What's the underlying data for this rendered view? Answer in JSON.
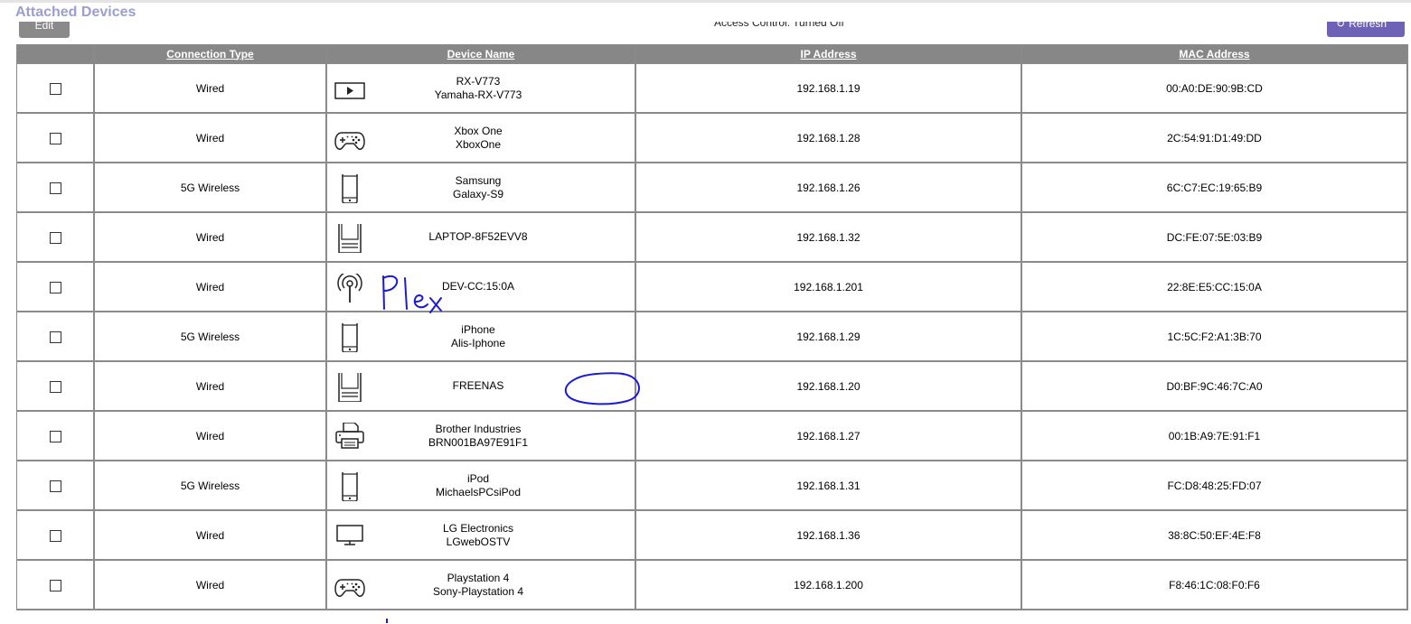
{
  "page": {
    "title": "Attached Devices",
    "edit_label": "Edit",
    "access_control": "Access Control: Turned Off",
    "refresh_label": "Refresh"
  },
  "table": {
    "headers": [
      "",
      "Connection Type",
      "Device Name",
      "IP Address",
      "MAC Address"
    ],
    "rows": [
      {
        "connection": "Wired",
        "icon": "media-player-icon",
        "name1": "RX-V773",
        "name2": "Yamaha-RX-V773",
        "ip": "192.168.1.19",
        "mac": "00:A0:DE:90:9B:CD"
      },
      {
        "connection": "Wired",
        "icon": "gamepad-icon",
        "name1": "Xbox One",
        "name2": "XboxOne",
        "ip": "192.168.1.28",
        "mac": "2C:54:91:D1:49:DD"
      },
      {
        "connection": "5G Wireless",
        "icon": "smartphone-icon",
        "name1": "Samsung",
        "name2": "Galaxy-S9",
        "ip": "192.168.1.26",
        "mac": "6C:C7:EC:19:65:B9"
      },
      {
        "connection": "Wired",
        "icon": "computer-icon",
        "name1": "LAPTOP-8F52EVV8",
        "name2": "",
        "ip": "192.168.1.32",
        "mac": "DC:FE:07:5E:03:B9"
      },
      {
        "connection": "Wired",
        "icon": "antenna-icon",
        "name1": "DEV-CC:15:0A",
        "name2": "",
        "ip": "192.168.1.201",
        "mac": "22:8E:E5:CC:15:0A"
      },
      {
        "connection": "5G Wireless",
        "icon": "smartphone-icon",
        "name1": "iPhone",
        "name2": "Alis-Iphone",
        "ip": "192.168.1.29",
        "mac": "1C:5C:F2:A1:3B:70"
      },
      {
        "connection": "Wired",
        "icon": "computer-icon",
        "name1": "FREENAS",
        "name2": "",
        "ip": "192.168.1.20",
        "mac": "D0:BF:9C:46:7C:A0"
      },
      {
        "connection": "Wired",
        "icon": "printer-icon",
        "name1": "Brother Industries",
        "name2": "BRN001BA97E91F1",
        "ip": "192.168.1.27",
        "mac": "00:1B:A9:7E:91:F1"
      },
      {
        "connection": "5G Wireless",
        "icon": "smartphone-icon",
        "name1": "iPod",
        "name2": "MichaelsPCsiPod",
        "ip": "192.168.1.31",
        "mac": "FC:D8:48:25:FD:07"
      },
      {
        "connection": "Wired",
        "icon": "monitor-icon",
        "name1": "LG Electronics",
        "name2": "LGwebOSTV",
        "ip": "192.168.1.36",
        "mac": "38:8C:50:EF:4E:F8"
      },
      {
        "connection": "Wired",
        "icon": "gamepad-icon",
        "name1": "Playstation 4",
        "name2": "Sony-Playstation 4",
        "ip": "192.168.1.200",
        "mac": "F8:46:1C:08:F0:F6"
      }
    ]
  },
  "annotations": {
    "handwritten_note": "Plex",
    "ink_color": "#1a1ad8"
  }
}
